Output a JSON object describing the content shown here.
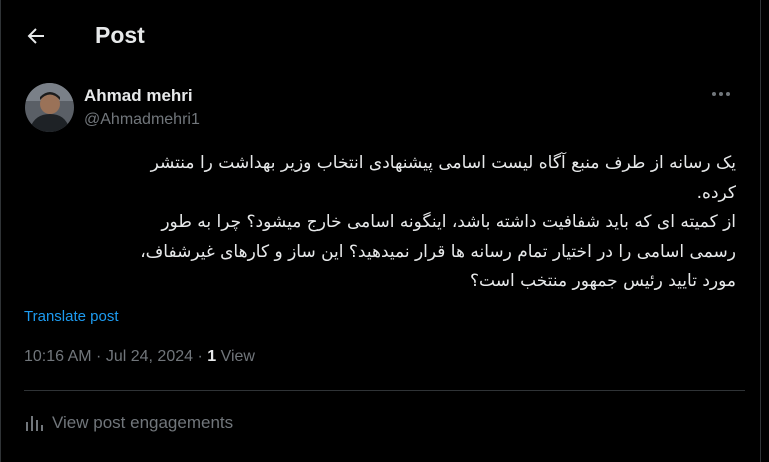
{
  "header": {
    "title": "Post",
    "back_icon": "arrow-left-icon"
  },
  "author": {
    "name": "Ahmad mehri",
    "handle": "@Ahmadmehri1"
  },
  "tweet": {
    "lines": [
      "یک رسانه از طرف منبع آگاه لیست اسامی پیشنهادی انتخاب وزیر بهداشت را منتشر",
      "کرده.",
      "از کمیته ای که باید شفافیت داشته باشد، اینگونه اسامی خارج میشود؟ چرا به طور",
      "رسمی اسامی را در اختیار تمام رسانه ها قرار نمیدهید؟ این ساز و کارهای غیرشفاف،",
      "مورد تایید رئیس جمهور منتخب است؟"
    ],
    "translate_label": "Translate post"
  },
  "meta": {
    "time": "10:16 AM",
    "separator": " · ",
    "date": "Jul 24, 2024",
    "views_count": "1",
    "views_label": "View"
  },
  "engagements": {
    "label": "View post engagements",
    "icon": "bar-chart-icon"
  },
  "colors": {
    "background": "#000000",
    "text": "#e7e9ea",
    "muted": "#71767b",
    "link": "#1d9bf0",
    "border": "#2f3336"
  }
}
